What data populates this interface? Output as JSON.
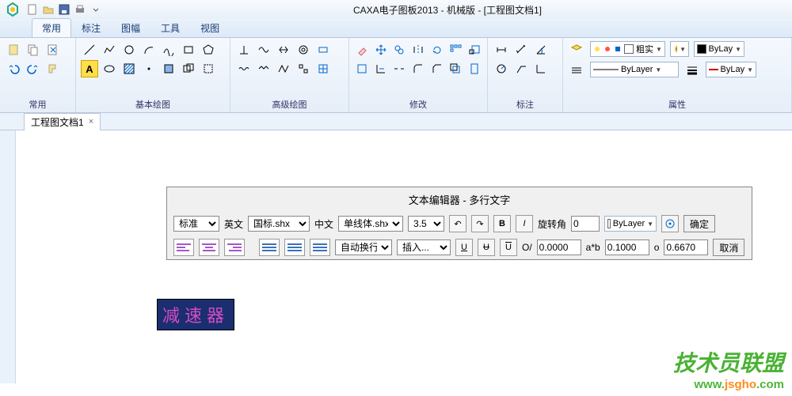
{
  "app": {
    "title": "CAXA电子图板2013 - 机械版 - [工程图文档1]"
  },
  "menu_tabs": [
    "常用",
    "标注",
    "图幅",
    "工具",
    "视图"
  ],
  "active_tab": 0,
  "ribbon_panels": [
    "常用",
    "基本绘图",
    "高级绘图",
    "修改",
    "标注",
    "属性"
  ],
  "attr": {
    "lineweight": "粗实",
    "color": "ByLay",
    "layer": "ByLayer",
    "linetype": "ByLay"
  },
  "doc_tab": "工程图文档1",
  "editor": {
    "title": "文本编辑器 - 多行文字",
    "style_label": "标准",
    "en_label": "英文",
    "en_font": "国标.shx",
    "cn_label": "中文",
    "cn_font": "单线体.shx",
    "size": "3.5",
    "rotate_label": "旋转角",
    "rotate_val": "0",
    "bylayer": "ByLayer",
    "ok": "确定",
    "cancel": "取消",
    "wrap": "自动换行",
    "insert": "插入...",
    "O_label": "O/",
    "O_val": "0.0000",
    "ab_label": "a*b",
    "ab_val": "0.1000",
    "o2_label": "o",
    "o2_val": "0.6670"
  },
  "sample_text": "减速器",
  "logo": {
    "name": "技术员联盟",
    "url_pre": "www.",
    "url_mid": "jsgho",
    "url_suf": ".com"
  }
}
